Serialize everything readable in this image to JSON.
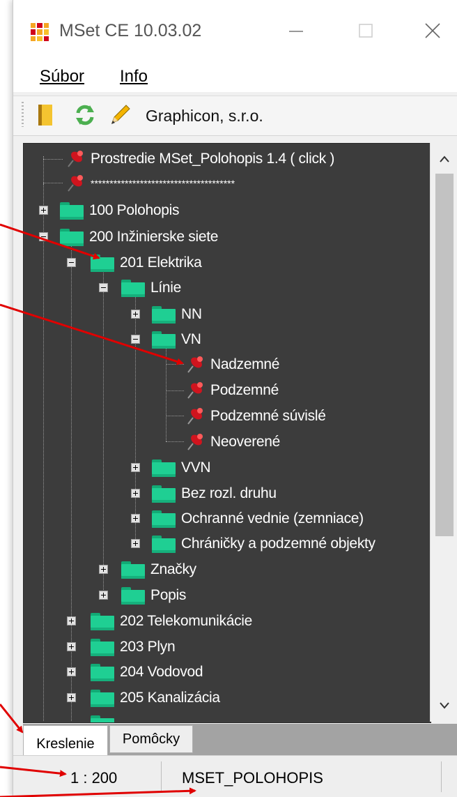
{
  "window": {
    "title": "MSet CE 10.03.02",
    "minimize_glyph": "—",
    "maximize_glyph": "☐",
    "close_glyph": "✕",
    "icon": "mset-grid-icon"
  },
  "menu": {
    "file_label": "Súbor",
    "info_label": "Info"
  },
  "toolbar": {
    "icons": [
      "open-book-icon",
      "refresh-icon",
      "pencil-icon"
    ],
    "company_label": "Graphicon, s.r.o."
  },
  "tree": {
    "nodes": [
      {
        "label": "Prostredie MSet_Polohopis 1.4 ( click )",
        "icon": "pushpin-icon"
      },
      {
        "label": "**************************************",
        "icon": "pushpin-icon"
      },
      {
        "label": "100 Polohopis",
        "icon": "folder-icon",
        "expander": "plus"
      },
      {
        "label": "200 Inžinierske siete",
        "icon": "folder-icon",
        "expander": "minus"
      },
      {
        "label": "201 Elektrika",
        "icon": "folder-icon",
        "expander": "minus"
      },
      {
        "label": "Línie",
        "icon": "folder-icon",
        "expander": "minus"
      },
      {
        "label": "NN",
        "icon": "folder-icon",
        "expander": "plus"
      },
      {
        "label": "VN",
        "icon": "folder-icon",
        "expander": "minus"
      },
      {
        "label": "Nadzemné",
        "icon": "pushpin-icon"
      },
      {
        "label": "Podzemné",
        "icon": "pushpin-icon"
      },
      {
        "label": "Podzemné súvislé",
        "icon": "pushpin-icon"
      },
      {
        "label": "Neoverené",
        "icon": "pushpin-icon"
      },
      {
        "label": "VVN",
        "icon": "folder-icon",
        "expander": "plus"
      },
      {
        "label": "Bez rozl. druhu",
        "icon": "folder-icon",
        "expander": "plus"
      },
      {
        "label": "Ochranné vednie (zemniace)",
        "icon": "folder-icon",
        "expander": "plus"
      },
      {
        "label": "Chráničky a podzemné objekty",
        "icon": "folder-icon",
        "expander": "plus"
      },
      {
        "label": "Značky",
        "icon": "folder-icon",
        "expander": "plus"
      },
      {
        "label": "Popis",
        "icon": "folder-icon",
        "expander": "plus"
      },
      {
        "label": "202 Telekomunikácie",
        "icon": "folder-icon",
        "expander": "plus"
      },
      {
        "label": "203 Plyn",
        "icon": "folder-icon",
        "expander": "plus"
      },
      {
        "label": "204 Vodovod",
        "icon": "folder-icon",
        "expander": "plus"
      },
      {
        "label": "205 Kanalizácia",
        "icon": "folder-icon",
        "expander": "plus"
      }
    ]
  },
  "scrollbar": {
    "up_icon": "chevron-up-icon",
    "down_icon": "chevron-down-icon"
  },
  "tabs": [
    {
      "label": "Kreslenie",
      "active": true
    },
    {
      "label": "Pomôcky",
      "active": false
    }
  ],
  "status": {
    "scale": "1 : 200",
    "environment": "MSET_POLOHOPIS"
  },
  "colors": {
    "tree_background": "#3c3c3c",
    "folder_green": "#1fcf93",
    "pin_red": "#d0141e",
    "annotation_arrow": "#e00000"
  }
}
